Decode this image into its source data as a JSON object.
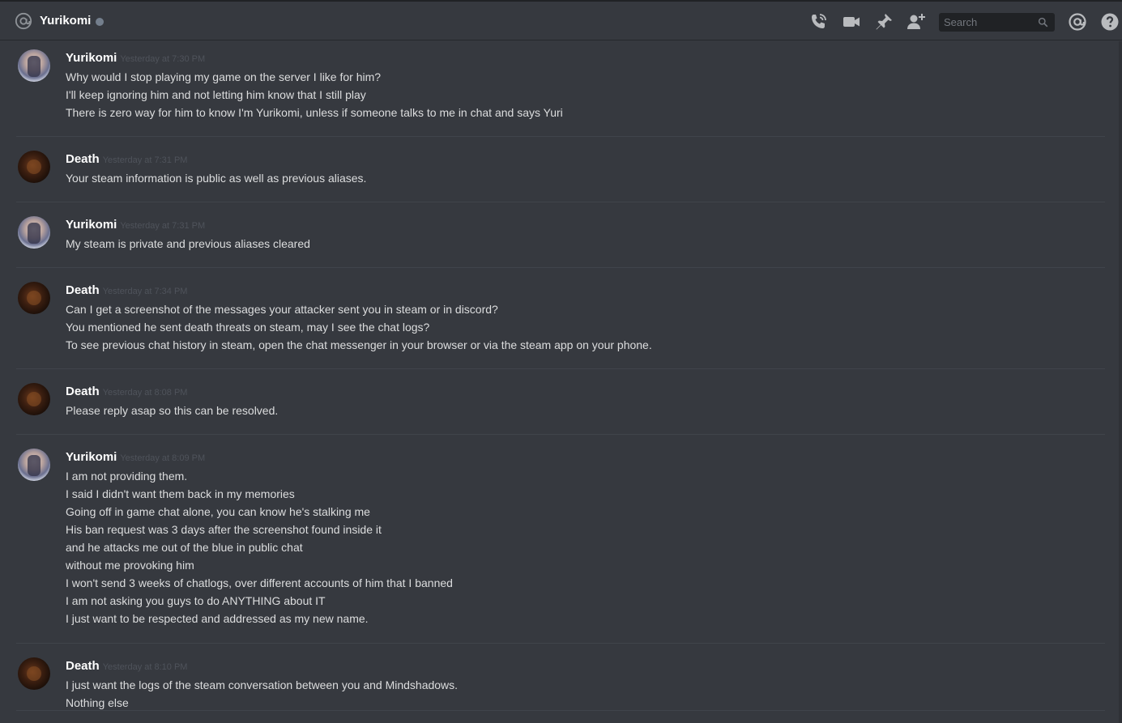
{
  "header": {
    "title": "Yurikomi",
    "status_color": "#747f8d",
    "search_placeholder": "Search",
    "icons": [
      "at-icon",
      "call-icon",
      "video-icon",
      "pin-icon",
      "add-friend-icon",
      "search-icon",
      "mention-icon",
      "help-icon"
    ]
  },
  "messages": [
    {
      "author": "Yurikomi",
      "timestamp": "Yesterday at 7:30 PM",
      "lines": [
        "Why would I stop playing my game on the server I like for him?",
        "I'll keep ignoring him and not letting him know that I still play",
        "There is zero way for him to know I'm Yurikomi, unless if someone talks to me in chat and says Yuri"
      ]
    },
    {
      "author": "Death",
      "timestamp": "Yesterday at 7:31 PM",
      "lines": [
        "Your steam information is public as well as previous aliases."
      ]
    },
    {
      "author": "Yurikomi",
      "timestamp": "Yesterday at 7:31 PM",
      "lines": [
        "My steam is private and previous aliases cleared"
      ]
    },
    {
      "author": "Death",
      "timestamp": "Yesterday at 7:34 PM",
      "lines": [
        "Can I get a screenshot of the messages your attacker sent you in steam or in discord?",
        "You mentioned he sent death threats on steam, may I see the chat logs?",
        "To see previous chat history in steam, open the chat messenger in your browser or via the steam app on your phone."
      ]
    },
    {
      "author": "Death",
      "timestamp": "Yesterday at 8:08 PM",
      "lines": [
        "Please reply asap so this can be resolved."
      ]
    },
    {
      "author": "Yurikomi",
      "timestamp": "Yesterday at 8:09 PM",
      "lines": [
        "I am not providing them.",
        "I said I didn't want them back in my memories",
        "Going off in game chat alone, you can know he's stalking me",
        "His ban request was 3 days after the screenshot found inside it",
        "and he attacks me out of the blue in public chat",
        "without me provoking him",
        "I won't send 3 weeks of chatlogs, over different accounts of him that I banned",
        "I am not asking you guys to do ANYTHING about IT",
        "I just want to be respected and addressed as my new name."
      ]
    },
    {
      "author": "Death",
      "timestamp": "Yesterday at 8:10 PM",
      "lines": [
        "I just want the logs of the steam conversation between you and Mindshadows.",
        "Nothing else"
      ]
    }
  ]
}
